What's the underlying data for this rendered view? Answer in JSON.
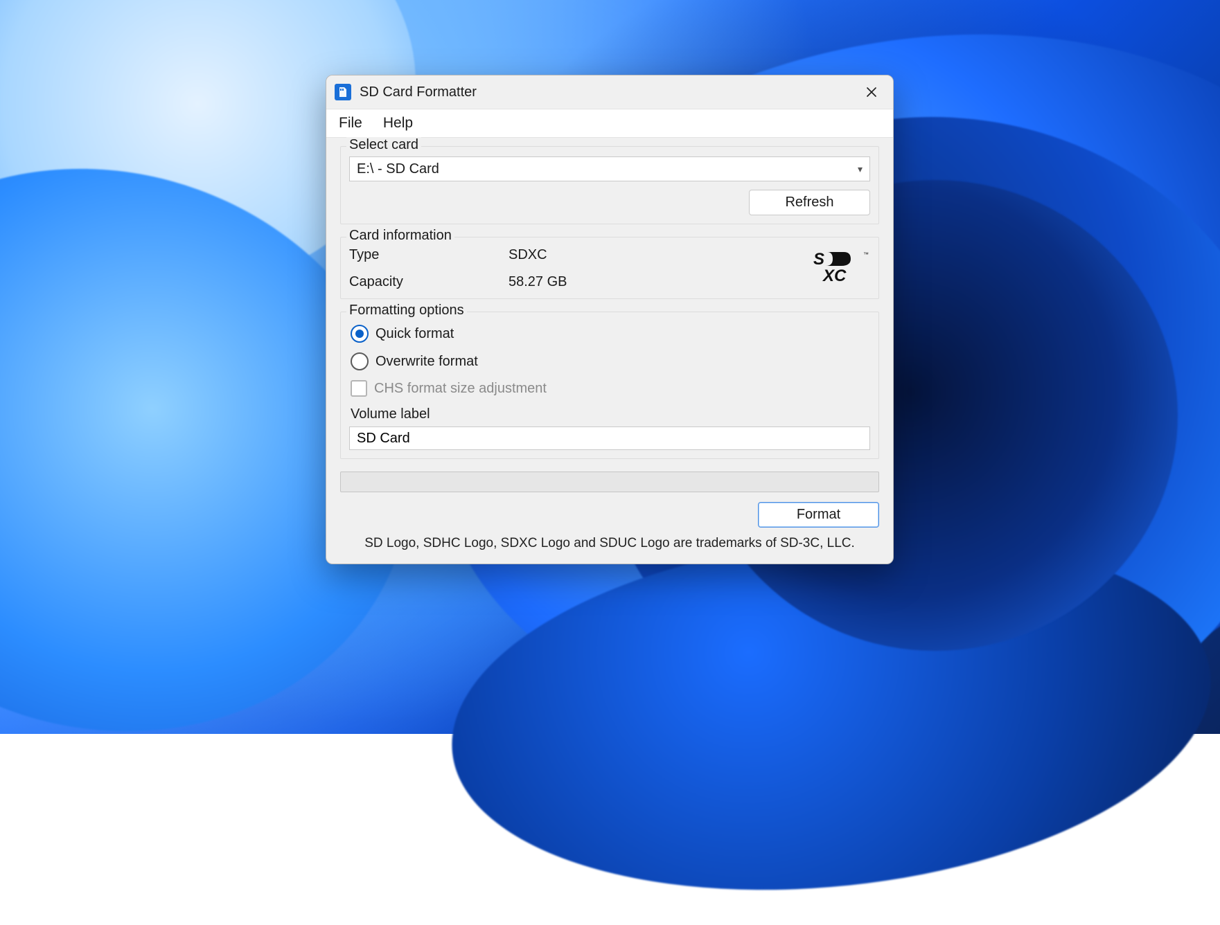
{
  "window": {
    "title": "SD Card Formatter"
  },
  "menu": {
    "file": "File",
    "help": "Help"
  },
  "select_card": {
    "legend": "Select card",
    "value": "E:\\ - SD Card",
    "refresh": "Refresh"
  },
  "card_info": {
    "legend": "Card information",
    "type_label": "Type",
    "type_value": "SDXC",
    "capacity_label": "Capacity",
    "capacity_value": "58.27 GB"
  },
  "formatting": {
    "legend": "Formatting options",
    "quick": "Quick format",
    "overwrite": "Overwrite format",
    "chs": "CHS format size adjustment",
    "volume_label_caption": "Volume label",
    "volume_label_value": "SD Card"
  },
  "actions": {
    "format": "Format"
  },
  "footer": "SD Logo, SDHC Logo, SDXC Logo and SDUC Logo are trademarks of SD-3C, LLC."
}
